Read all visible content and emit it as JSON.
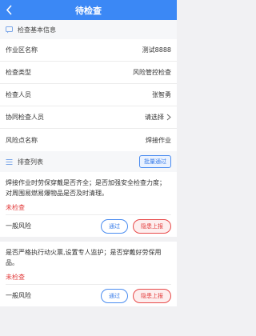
{
  "header": {
    "title": "待检查"
  },
  "basic_section": {
    "title": "检查基本信息"
  },
  "info_rows": [
    {
      "label": "作业区名称",
      "value": "测试8888"
    },
    {
      "label": "检查类型",
      "value": "风险管控检查"
    },
    {
      "label": "检查人员",
      "value": "张智勇"
    },
    {
      "label": "协同检查人员",
      "value": "请选择"
    },
    {
      "label": "风险点名称",
      "value": "焊接作业"
    }
  ],
  "list_section": {
    "title": "排查列表",
    "batch_label": "批量通过"
  },
  "items": [
    {
      "desc": "焊接作业时劳保穿戴是否齐全；是否加强安全检查力度；对周围易燃易爆物品是否及时清理。",
      "status": "未检查",
      "risk": "一般风险",
      "pass_label": "通过",
      "report_label": "隐患上报"
    },
    {
      "desc": "是否严格执行动火票,设置专人监护；是否穿戴好劳保用品。",
      "status": "未检查",
      "risk": "一般风险",
      "pass_label": "通过",
      "report_label": "隐患上报"
    }
  ]
}
